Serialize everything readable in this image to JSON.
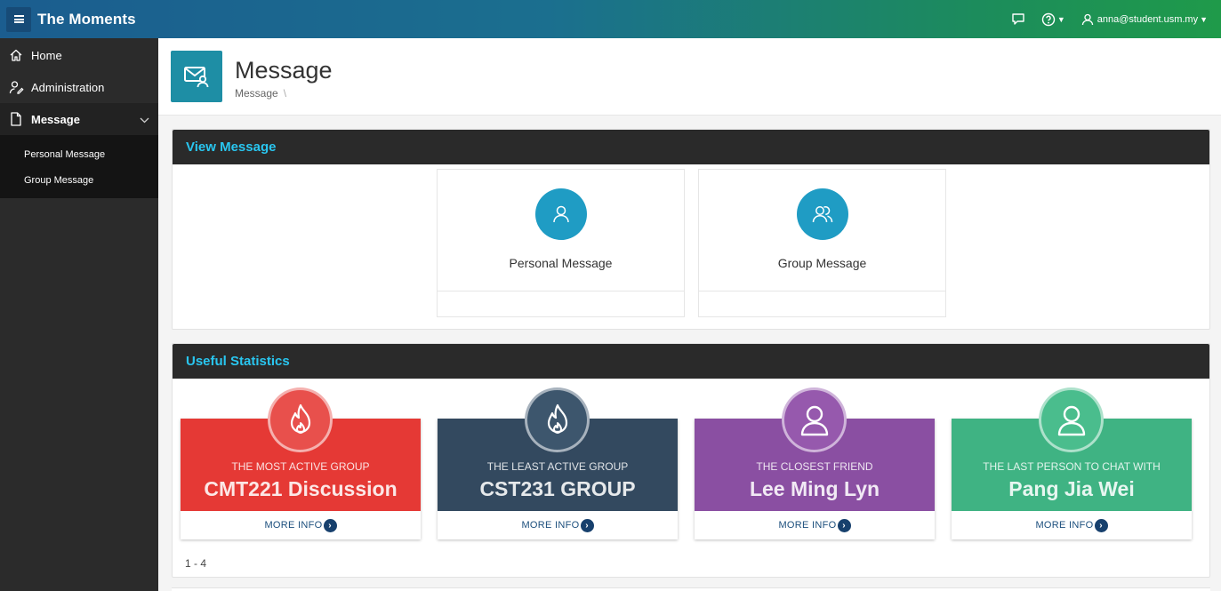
{
  "app": {
    "title": "The Moments"
  },
  "topbar": {
    "user": "anna@student.usm.my",
    "icons": [
      "chat-icon",
      "help-icon",
      "user-icon"
    ]
  },
  "sidebar": {
    "items": [
      {
        "label": "Home",
        "icon": "home-icon"
      },
      {
        "label": "Administration",
        "icon": "user-gear-icon"
      },
      {
        "label": "Message",
        "icon": "document-icon",
        "active": true,
        "expanded": true
      }
    ],
    "subitems": [
      {
        "label": "Personal Message"
      },
      {
        "label": "Group Message"
      }
    ]
  },
  "page": {
    "title": "Message",
    "breadcrumb": "Message",
    "breadcrumb_sep": "\\"
  },
  "view_region": {
    "title": "View Message",
    "cards": [
      {
        "label": "Personal Message",
        "icon": "user-icon"
      },
      {
        "label": "Group Message",
        "icon": "users-icon"
      }
    ]
  },
  "stats_region": {
    "title": "Useful Statistics",
    "items": [
      {
        "label": "THE MOST ACTIVE GROUP",
        "value": "CMT221 Discussion",
        "icon": "fire-icon",
        "color": "#e53935",
        "bubble": "#e8504c",
        "more": "MORE INFO"
      },
      {
        "label": "THE LEAST ACTIVE GROUP",
        "value": "CST231 GROUP",
        "icon": "fire-icon",
        "color": "#33495f",
        "bubble": "#3d566d",
        "more": "MORE INFO"
      },
      {
        "label": "THE CLOSEST FRIEND",
        "value": "Lee Ming Lyn",
        "icon": "user-icon",
        "color": "#8a4fa2",
        "bubble": "#9659ad",
        "more": "MORE INFO"
      },
      {
        "label": "THE LAST PERSON TO CHAT WITH",
        "value": "Pang Jia Wei",
        "icon": "user-icon",
        "color": "#3fb383",
        "bubble": "#4abd8d",
        "more": "MORE INFO"
      }
    ],
    "pagination": "1 - 4"
  }
}
